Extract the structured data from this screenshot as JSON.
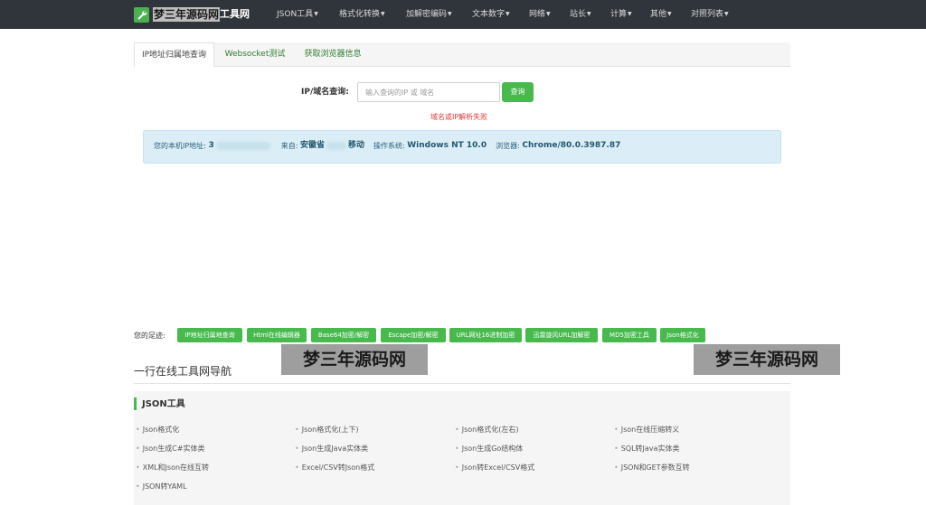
{
  "brand": {
    "watermark_text": "梦三年源码网",
    "suffix": "工具网"
  },
  "nav": [
    "JSON工具",
    "格式化转换",
    "加解密编码",
    "文本数字",
    "网络",
    "站长",
    "计算",
    "其他",
    "对照列表"
  ],
  "tabs": [
    "IP地址归属地查询",
    "Websocket测试",
    "获取浏览器信息"
  ],
  "query": {
    "label": "IP/域名查询:",
    "placeholder": "输入查询的IP 或 域名",
    "button": "查询",
    "error": "域名或IP解析失败"
  },
  "info": {
    "ip_label": "您的本机IP地址:",
    "ip_value": "3",
    "from_label": "来自:",
    "from_value": "安徽省",
    "carrier": "移动",
    "os_label": "操作系统:",
    "os_value": "Windows NT 10.0",
    "browser_label": "浏览器:",
    "browser_value": "Chrome/80.0.3987.87"
  },
  "footprints": {
    "label": "您的足迹:",
    "items": [
      "IP地址归属地查询",
      "Html在线编辑器",
      "Base64加密/解密",
      "Escape加密/解密",
      "URL网址16进制加密",
      "迅雷旋风URL加解密",
      "MD5加密工具",
      "Json格式化"
    ]
  },
  "watermark": "梦三年源码网",
  "nav_title": "一行在线工具网导航",
  "json_section": {
    "title": "JSON工具",
    "tools": [
      "Json格式化",
      "Json格式化(上下)",
      "Json格式化(左右)",
      "Json在线压缩转义",
      "Json生成C#实体类",
      "Json生成Java实体类",
      "Json生成Go结构体",
      "SQL转Java实体类",
      "XML和Json在线互转",
      "Excel/CSV转Json格式",
      "Json转Excel/CSV格式",
      "JSON和GET参数互转",
      "JSON转YAML"
    ]
  },
  "colors": {
    "navbar": "#2f353b",
    "accent": "#47b94d",
    "error": "#e53935",
    "info_bg": "#dbeef7"
  }
}
